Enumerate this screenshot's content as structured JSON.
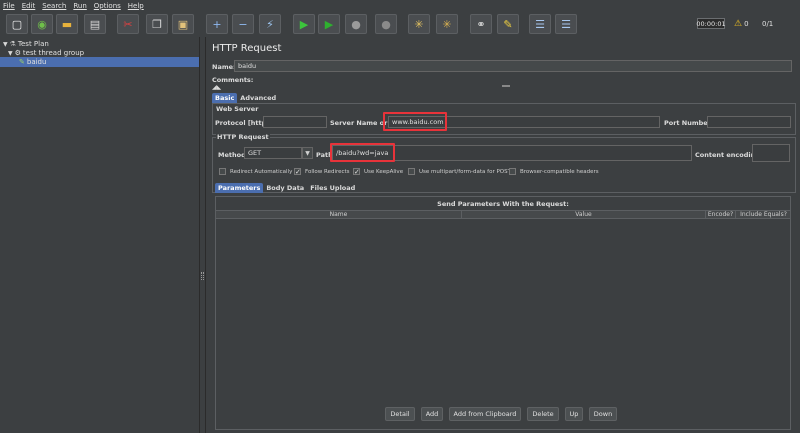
{
  "menu": [
    "File",
    "Edit",
    "Search",
    "Run",
    "Options",
    "Help"
  ],
  "toolbar": {
    "timer": "00:00:01",
    "warnings": "0",
    "threads": "0/1",
    "buttons": [
      {
        "name": "new-icon",
        "glyph": "▢",
        "color": "#f2f2f2"
      },
      {
        "name": "templates-icon",
        "glyph": "◉",
        "color": "#6fbf4a"
      },
      {
        "name": "open-icon",
        "glyph": "▬",
        "color": "#e8b23c"
      },
      {
        "name": "save-icon",
        "glyph": "▤",
        "color": "#d8d8d8"
      },
      {
        "name": "cut-icon",
        "glyph": "✂",
        "color": "#e04040"
      },
      {
        "name": "copy-icon",
        "glyph": "❐",
        "color": "#d8d8d8"
      },
      {
        "name": "paste-icon",
        "glyph": "▣",
        "color": "#e2c27a"
      },
      {
        "name": "expand-icon",
        "glyph": "+",
        "color": "#8fb8f0"
      },
      {
        "name": "collapse-icon",
        "glyph": "−",
        "color": "#8fb8f0"
      },
      {
        "name": "toggle-icon",
        "glyph": "⚡",
        "color": "#9cc4ee"
      },
      {
        "name": "start-icon",
        "glyph": "▶",
        "color": "#3cc43c"
      },
      {
        "name": "start-no-pauses-icon",
        "glyph": "▶",
        "color": "#2fb02f"
      },
      {
        "name": "stop-icon",
        "glyph": "●",
        "color": "#9a9a9a"
      },
      {
        "name": "shutdown-icon",
        "glyph": "●",
        "color": "#8a8a8a"
      },
      {
        "name": "clear-icon",
        "glyph": "✳",
        "color": "#e0c060"
      },
      {
        "name": "clear-all-icon",
        "glyph": "✳",
        "color": "#d8b050"
      },
      {
        "name": "search-icon",
        "glyph": "⚭",
        "color": "#d8d8d8"
      },
      {
        "name": "reset-search-icon",
        "glyph": "✎",
        "color": "#f0d040"
      },
      {
        "name": "function-helper-icon",
        "glyph": "☰",
        "color": "#a8c8f0"
      },
      {
        "name": "help-icon",
        "glyph": "☰",
        "color": "#a8c8f0"
      }
    ]
  },
  "tree": {
    "items": [
      {
        "label": "Test Plan",
        "icon": "test-plan-icon"
      },
      {
        "label": "test thread group",
        "icon": "thread-group-icon"
      },
      {
        "label": "baidu",
        "icon": "sampler-icon"
      }
    ]
  },
  "panel": {
    "title": "HTTP Request",
    "name_label": "Name:",
    "name_value": "baidu",
    "comments_label": "Comments:",
    "tabs": [
      "Basic",
      "Advanced"
    ],
    "web_server_label": "Web Server",
    "protocol_label": "Protocol [http]:",
    "protocol_value": "",
    "server_label": "Server Name or IP:",
    "server_value": "www.baidu.com",
    "port_label": "Port Number:",
    "port_value": "",
    "http_request_label": "HTTP Request",
    "method_label": "Method:",
    "method_value": "GET",
    "path_label": "Path:",
    "path_value": "/baidu?wd=java",
    "encoding_label": "Content encoding:",
    "encoding_value": "",
    "checkboxes": [
      {
        "label": "Redirect Automatically",
        "checked": false
      },
      {
        "label": "Follow Redirects",
        "checked": true
      },
      {
        "label": "Use KeepAlive",
        "checked": true
      },
      {
        "label": "Use multipart/form-data for POST",
        "checked": false
      },
      {
        "label": "Browser-compatible headers",
        "checked": false
      }
    ],
    "sub_tabs": [
      "Parameters",
      "Body Data",
      "Files Upload"
    ],
    "table_title": "Send Parameters With the Request:",
    "columns": [
      "Name",
      "Value",
      "Encode?",
      "Include Equals?"
    ],
    "buttons": [
      "Detail",
      "Add",
      "Add from Clipboard",
      "Delete",
      "Up",
      "Down"
    ]
  },
  "colors": {
    "accent": "#4b6eaf",
    "highlight": "#e8333a",
    "background": "#3c3f41"
  }
}
